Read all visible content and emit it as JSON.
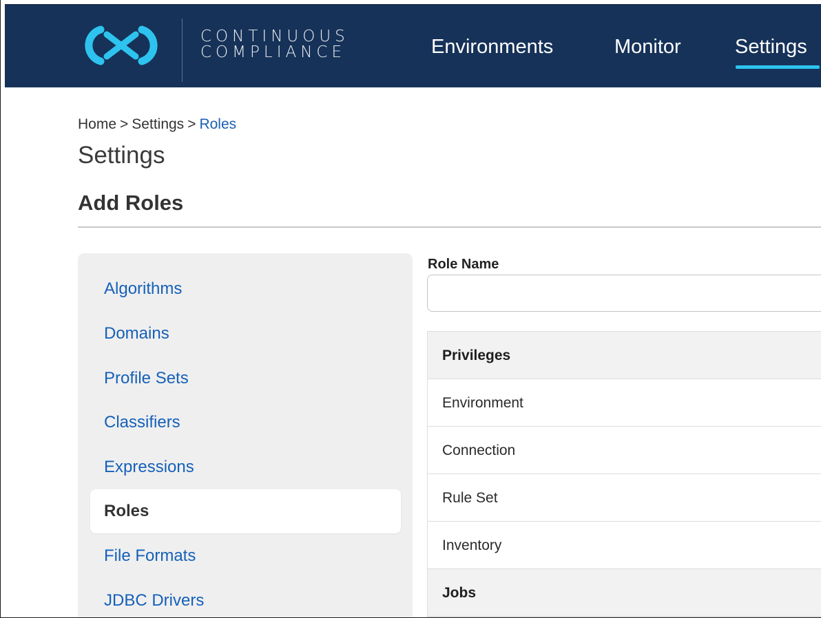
{
  "header": {
    "brand_line1": "CONTINUOUS",
    "brand_line2": "COMPLIANCE",
    "nav": [
      {
        "label": "Environments",
        "active": false
      },
      {
        "label": "Monitor",
        "active": false
      },
      {
        "label": "Settings",
        "active": true
      }
    ],
    "colors": {
      "navbar": "#163259",
      "accent": "#2ec3ef"
    }
  },
  "breadcrumb": [
    {
      "label": "Home"
    },
    {
      "label": "Settings"
    },
    {
      "label": "Roles",
      "link": true
    }
  ],
  "breadcrumb_separator": ">",
  "page_title": "Settings",
  "section_title": "Add Roles",
  "sidebar": {
    "items": [
      {
        "label": "Algorithms",
        "active": false
      },
      {
        "label": "Domains",
        "active": false
      },
      {
        "label": "Profile Sets",
        "active": false
      },
      {
        "label": "Classifiers",
        "active": false
      },
      {
        "label": "Expressions",
        "active": false
      },
      {
        "label": "Roles",
        "active": true
      },
      {
        "label": "File Formats",
        "active": false
      },
      {
        "label": "JDBC Drivers",
        "active": false
      }
    ]
  },
  "form": {
    "role_name_label": "Role Name",
    "role_name_value": "",
    "role_name_placeholder": ""
  },
  "privileges": {
    "rows": [
      {
        "label": "Privileges",
        "type": "header"
      },
      {
        "label": "Environment",
        "type": "item"
      },
      {
        "label": "Connection",
        "type": "item"
      },
      {
        "label": "Rule Set",
        "type": "item"
      },
      {
        "label": "Inventory",
        "type": "item"
      },
      {
        "label": "Jobs",
        "type": "header"
      }
    ]
  },
  "icons": {
    "logo": "continuous-compliance-logo-icon"
  }
}
